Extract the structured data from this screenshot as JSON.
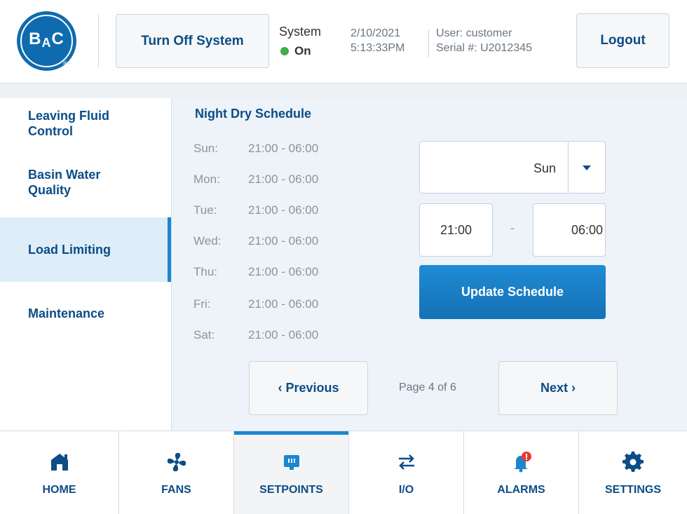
{
  "header": {
    "logo": {
      "top": "B",
      "mid": "A",
      "sub": "C",
      "reg": "®"
    },
    "turn_off_label": "Turn Off System",
    "system_label": "System",
    "system_status": "On",
    "date": "2/10/2021",
    "time": "5:13:33PM",
    "user": "User: customer",
    "serial": "Serial #: U2012345",
    "logout_label": "Logout"
  },
  "sidebar": {
    "items": [
      {
        "line1": "Leaving Fluid",
        "line2": "Control",
        "active": false
      },
      {
        "line1": "Basin Water",
        "line2": "Quality",
        "active": false
      },
      {
        "line1": "Load Limiting",
        "line2": "",
        "active": true
      },
      {
        "line1": "Maintenance",
        "line2": "",
        "active": false
      }
    ]
  },
  "schedule": {
    "title": "Night Dry Schedule",
    "rows": [
      {
        "day": "Sun:",
        "time": "21:00 - 06:00"
      },
      {
        "day": "Mon:",
        "time": "21:00 - 06:00"
      },
      {
        "day": "Tue:",
        "time": "21:00 - 06:00"
      },
      {
        "day": "Wed:",
        "time": "21:00 - 06:00"
      },
      {
        "day": "Thu:",
        "time": "21:00 - 06:00"
      },
      {
        "day": "Fri:",
        "time": "21:00 - 06:00"
      },
      {
        "day": "Sat:",
        "time": "21:00 - 06:00"
      }
    ],
    "day_select_value": "Sun",
    "start_time": "21:00",
    "separator": "-",
    "end_time": "06:00",
    "update_label": "Update Schedule"
  },
  "pagination": {
    "prev_label": "‹ Previous",
    "page_info": "Page 4 of 6",
    "next_label": "Next ›",
    "current_page": 4,
    "total_pages": 6
  },
  "bottom_nav": {
    "items": [
      {
        "label": "HOME",
        "icon": "home-icon",
        "active": false
      },
      {
        "label": "FANS",
        "icon": "fan-icon",
        "active": false
      },
      {
        "label": "SETPOINTS",
        "icon": "setpoints-icon",
        "active": true
      },
      {
        "label": "I/O",
        "icon": "io-arrows-icon",
        "active": false
      },
      {
        "label": "ALARMS",
        "icon": "alarm-bell-icon",
        "active": false
      },
      {
        "label": "SETTINGS",
        "icon": "gear-icon",
        "active": false
      }
    ]
  },
  "colors": {
    "brand_blue": "#0b4d86",
    "accent_blue": "#1a86cf",
    "status_green": "#3fae49",
    "alarm_red": "#e53b2c"
  }
}
